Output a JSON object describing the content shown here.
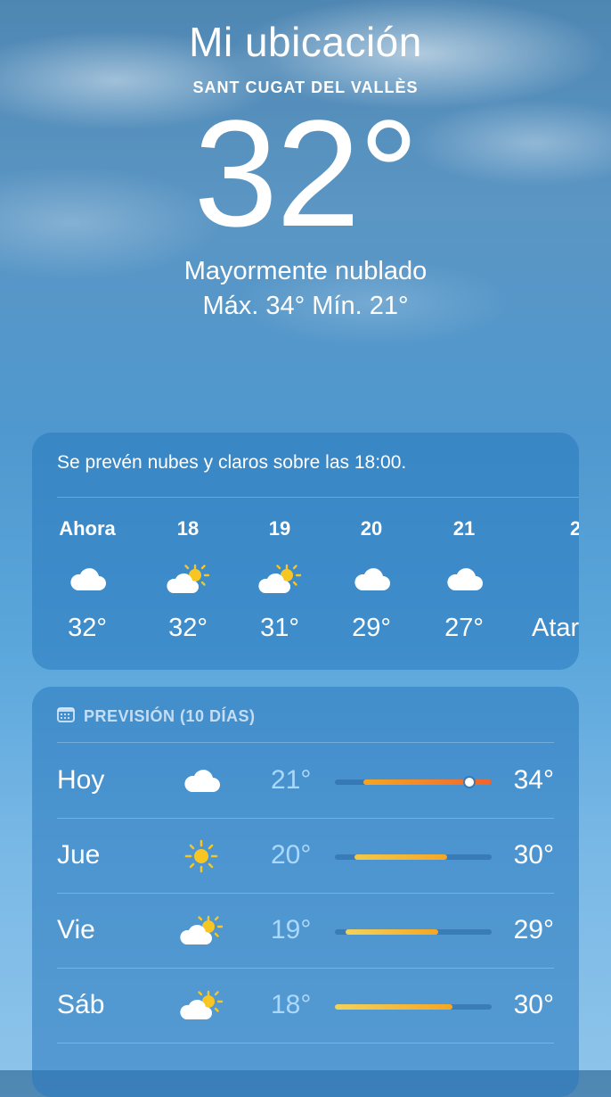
{
  "location": {
    "title": "Mi ubicación",
    "city": "SANT CUGAT DEL VALLÈS",
    "temperature": "32°",
    "condition": "Mayormente nublado",
    "high_low": "Máx. 34°  Mín. 21°"
  },
  "hourly": {
    "summary": "Se prevén nubes y claros sobre las 18:00.",
    "items": [
      {
        "hour": "Ahora",
        "icon": "cloud-icon",
        "temp": "32°"
      },
      {
        "hour": "18",
        "icon": "partly-sunny-icon",
        "temp": "32°"
      },
      {
        "hour": "19",
        "icon": "partly-sunny-icon",
        "temp": "31°"
      },
      {
        "hour": "20",
        "icon": "cloud-icon",
        "temp": "29°"
      },
      {
        "hour": "21",
        "icon": "cloud-icon",
        "temp": "27°"
      },
      {
        "hour": "2",
        "icon": "",
        "temp": "Atar"
      }
    ]
  },
  "daily": {
    "header": "PREVISIÓN (10 DÍAS)",
    "rows": [
      {
        "day": "Hoy",
        "icon": "cloud-icon",
        "low": "21°",
        "high": "34°"
      },
      {
        "day": "Jue",
        "icon": "sun-icon",
        "low": "20°",
        "high": "30°"
      },
      {
        "day": "Vie",
        "icon": "partly-sunny-icon",
        "low": "19°",
        "high": "29°"
      },
      {
        "day": "Sáb",
        "icon": "partly-sunny-icon",
        "low": "18°",
        "high": "30°"
      }
    ]
  },
  "colors": {
    "sun": "#f7c623",
    "bar_warm": "#f5a623",
    "bar_hot": "#f0642c",
    "bar_mild": "#f2c94c"
  }
}
